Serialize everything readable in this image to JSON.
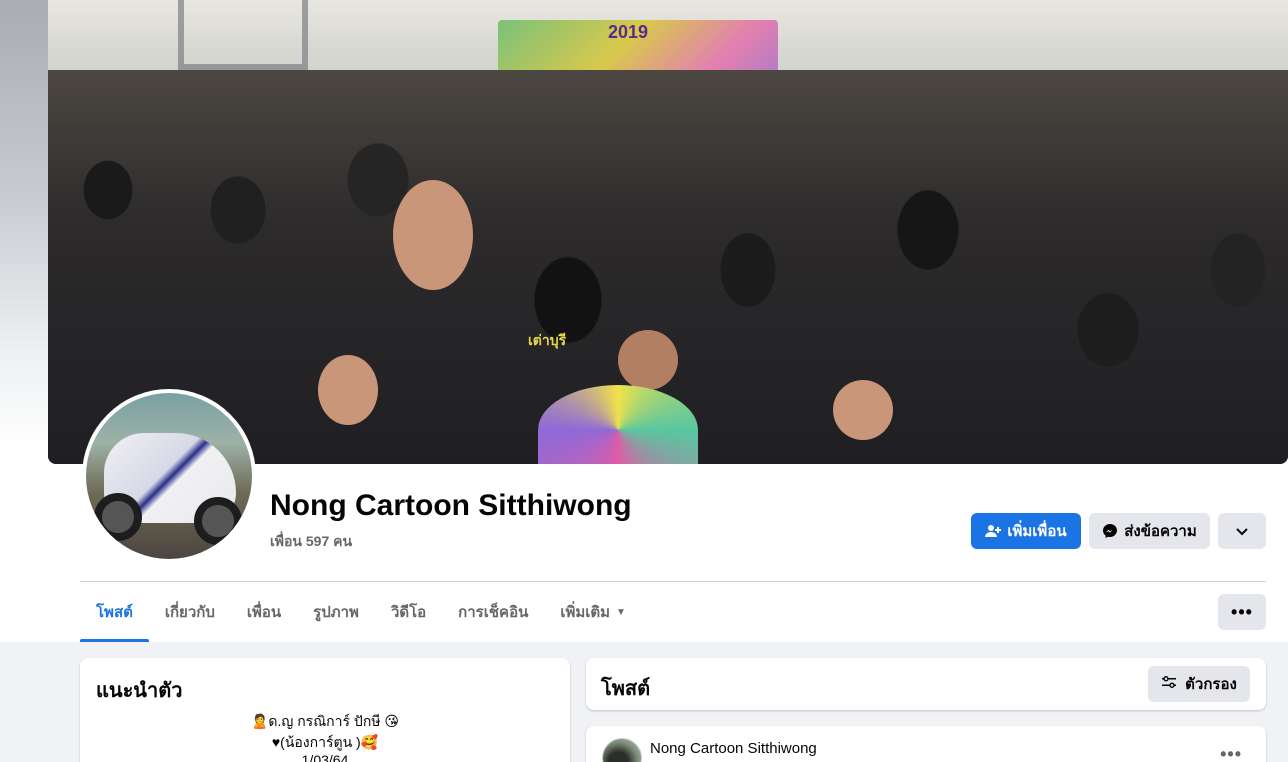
{
  "profile": {
    "name": "Nong Cartoon Sitthiwong",
    "friends_count": "เพื่อน 597 คน"
  },
  "cover": {
    "banner_text": "2019",
    "shirt_text": "เต่าบุรี"
  },
  "actions": {
    "add_friend_label": "เพิ่มเพื่อน",
    "message_label": "ส่งข้อความ"
  },
  "tabs": [
    {
      "label": "โพสต์"
    },
    {
      "label": "เกี่ยวกับ"
    },
    {
      "label": "เพื่อน"
    },
    {
      "label": "รูปภาพ"
    },
    {
      "label": "วิดีโอ"
    },
    {
      "label": "การเช็คอิน"
    },
    {
      "label": "เพิ่มเติม"
    }
  ],
  "intro": {
    "title": "แนะนำตัว",
    "bio_lines": [
      "🙎ด.ญ กรณิการ์ ปักษี 😘",
      "♥(น้องการ์ตูน )🥰",
      "1/03/64"
    ]
  },
  "posts": {
    "title": "โพสต์",
    "filter_label": "ตัวกรอง",
    "first_post_author": "Nong Cartoon Sitthiwong"
  },
  "colors": {
    "accent": "#1b74e4",
    "secondary_button": "#e4e6eb",
    "page_bg": "#f0f2f5"
  },
  "icons": {
    "add_friend": "person-plus-icon",
    "message": "messenger-icon",
    "chevron": "chevron-down-icon",
    "more": "more-dots-icon",
    "filter": "sliders-icon"
  }
}
